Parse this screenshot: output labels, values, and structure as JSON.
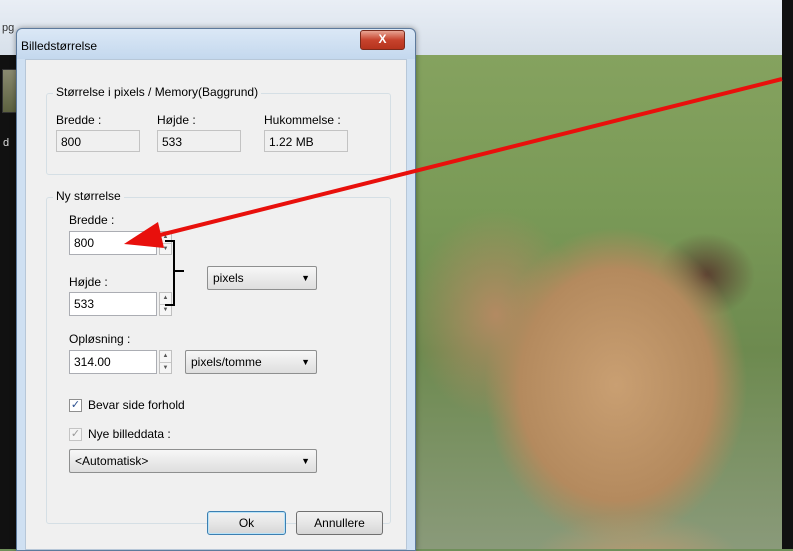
{
  "app": {
    "title_fragment": "pg",
    "left_glyph": "d"
  },
  "dialog": {
    "title": "Billedstørrelse",
    "close_label": "X",
    "current": {
      "legend": "Størrelse i pixels / Memory(Baggrund)",
      "width_label": "Bredde :",
      "width_value": "800",
      "height_label": "Højde :",
      "height_value": "533",
      "memory_label": "Hukommelse :",
      "memory_value": "1.22 MB"
    },
    "new_size": {
      "legend": "Ny størrelse",
      "width_label": "Bredde :",
      "width_value": "800",
      "height_label": "Højde :",
      "height_value": "533",
      "unit_selected": "pixels",
      "resolution_label": "Opløsning :",
      "resolution_value": "314.00",
      "resolution_unit_selected": "pixels/tomme",
      "keep_ratio_label": "Bevar side forhold",
      "keep_ratio_checked": true,
      "new_data_label": "Nye billeddata :",
      "new_data_checked": true,
      "resample_selected": "<Automatisk>"
    },
    "ok_label": "Ok",
    "cancel_label": "Annullere"
  },
  "colors": {
    "arrow": "#e8100c"
  }
}
